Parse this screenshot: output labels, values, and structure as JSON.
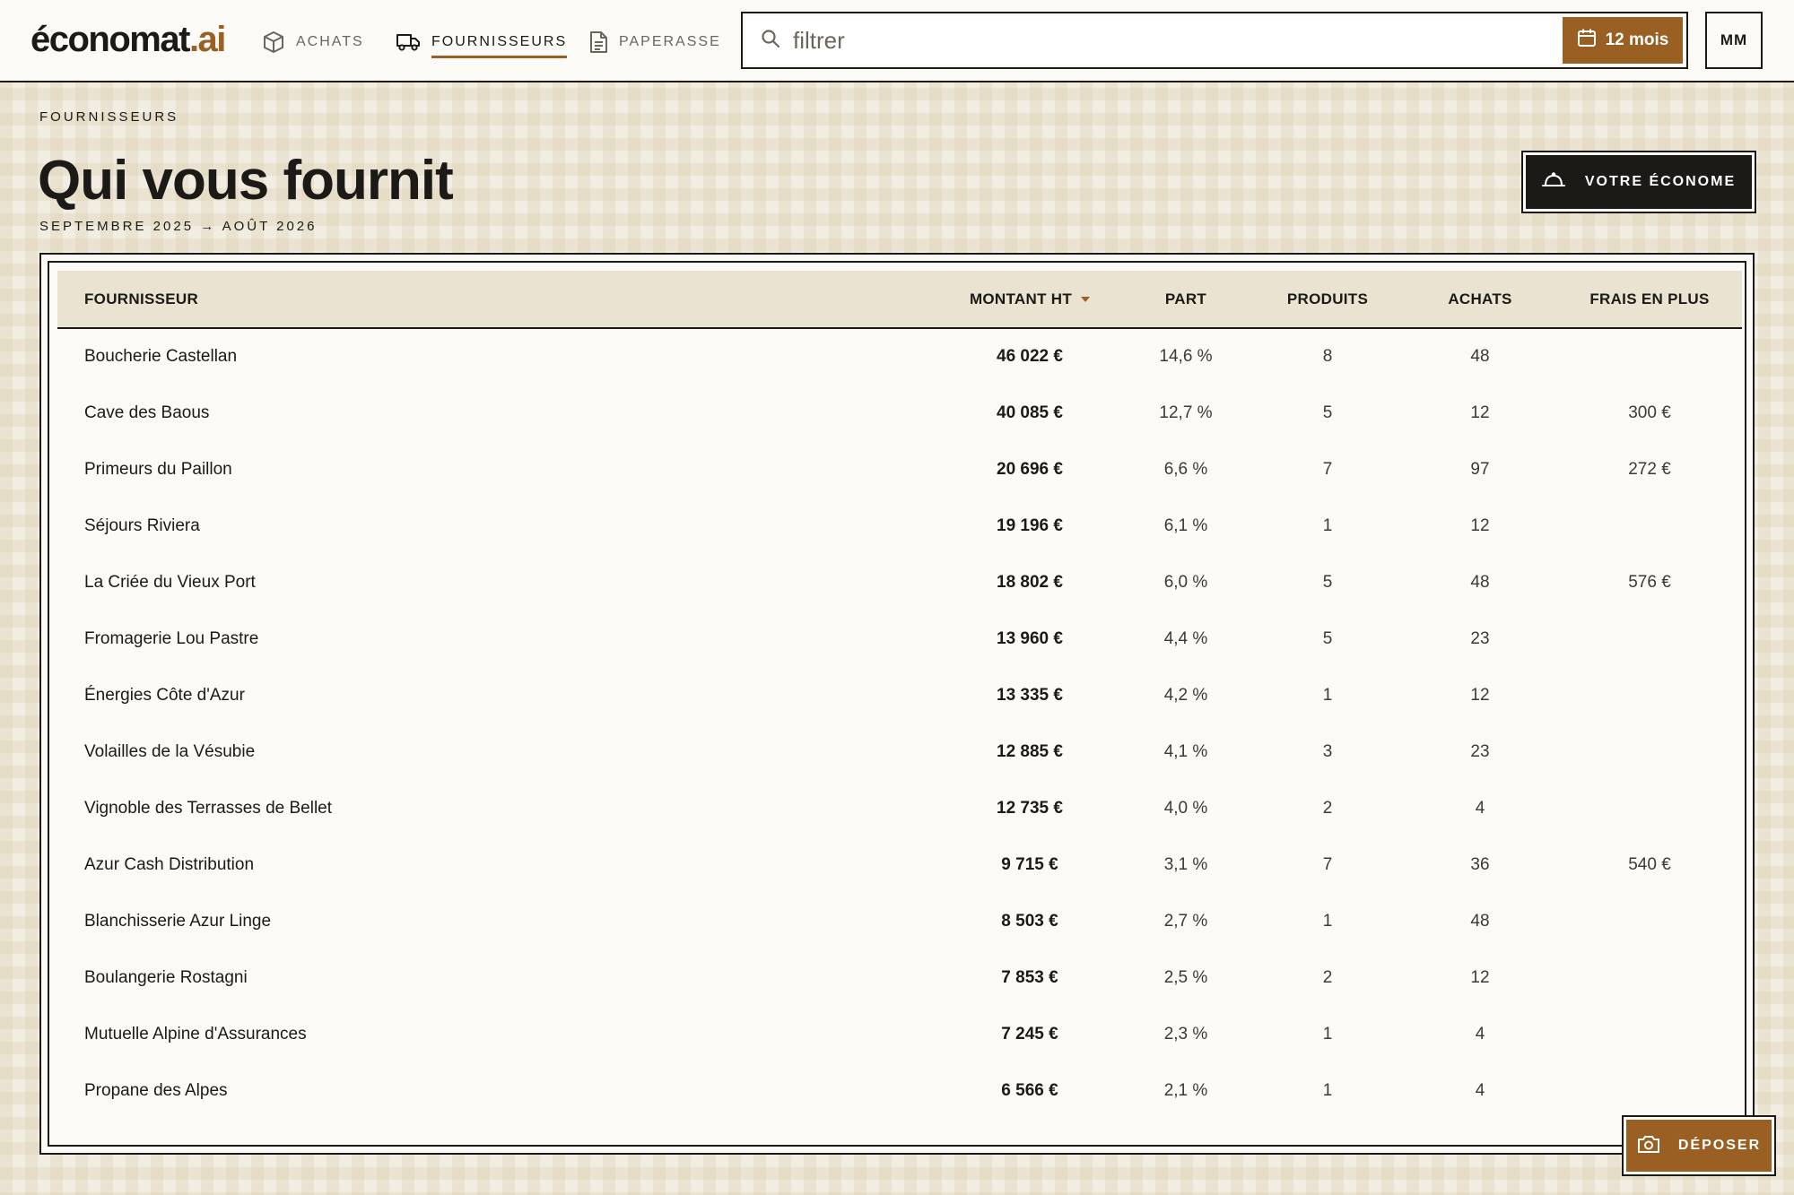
{
  "app": {
    "logo_main": "économat",
    "logo_accent": ".ai"
  },
  "nav": {
    "items": [
      {
        "label": "ACHATS",
        "icon": "box-icon",
        "active": false
      },
      {
        "label": "FOURNISSEURS",
        "icon": "truck-icon",
        "active": true
      },
      {
        "label": "PAPERASSE",
        "icon": "document-icon",
        "active": false
      }
    ]
  },
  "search": {
    "placeholder": "filtrer",
    "value": ""
  },
  "period": {
    "label": "12 mois",
    "icon": "calendar-icon"
  },
  "user": {
    "initials": "MM"
  },
  "header": {
    "eyebrow": "FOURNISSEURS",
    "title": "Qui vous fournit",
    "date_range": "SEPTEMBRE 2025 → AOÛT 2026",
    "econome_label": "VOTRE ÉCONOME",
    "econome_icon": "cloche-icon"
  },
  "table": {
    "columns": {
      "supplier": "FOURNISSEUR",
      "amount": "MONTANT HT",
      "share": "PART",
      "products": "PRODUITS",
      "purchases": "ACHATS",
      "extra_fees": "FRAIS EN PLUS"
    },
    "sort": {
      "column": "amount",
      "direction": "desc"
    },
    "rows": [
      {
        "name": "Boucherie Castellan",
        "amount": "46 022 €",
        "share": "14,6 %",
        "products": "8",
        "purchases": "48",
        "extra": ""
      },
      {
        "name": "Cave des Baous",
        "amount": "40 085 €",
        "share": "12,7 %",
        "products": "5",
        "purchases": "12",
        "extra": "300 €"
      },
      {
        "name": "Primeurs du Paillon",
        "amount": "20 696 €",
        "share": "6,6 %",
        "products": "7",
        "purchases": "97",
        "extra": "272 €"
      },
      {
        "name": "Séjours Riviera",
        "amount": "19 196 €",
        "share": "6,1 %",
        "products": "1",
        "purchases": "12",
        "extra": ""
      },
      {
        "name": "La Criée du Vieux Port",
        "amount": "18 802 €",
        "share": "6,0 %",
        "products": "5",
        "purchases": "48",
        "extra": "576 €"
      },
      {
        "name": "Fromagerie Lou Pastre",
        "amount": "13 960 €",
        "share": "4,4 %",
        "products": "5",
        "purchases": "23",
        "extra": ""
      },
      {
        "name": "Énergies Côte d'Azur",
        "amount": "13 335 €",
        "share": "4,2 %",
        "products": "1",
        "purchases": "12",
        "extra": ""
      },
      {
        "name": "Volailles de la Vésubie",
        "amount": "12 885 €",
        "share": "4,1 %",
        "products": "3",
        "purchases": "23",
        "extra": ""
      },
      {
        "name": "Vignoble des Terrasses de Bellet",
        "amount": "12 735 €",
        "share": "4,0 %",
        "products": "2",
        "purchases": "4",
        "extra": ""
      },
      {
        "name": "Azur Cash Distribution",
        "amount": "9 715 €",
        "share": "3,1 %",
        "products": "7",
        "purchases": "36",
        "extra": "540 €"
      },
      {
        "name": "Blanchisserie Azur Linge",
        "amount": "8 503 €",
        "share": "2,7 %",
        "products": "1",
        "purchases": "48",
        "extra": ""
      },
      {
        "name": "Boulangerie Rostagni",
        "amount": "7 853 €",
        "share": "2,5 %",
        "products": "2",
        "purchases": "12",
        "extra": ""
      },
      {
        "name": "Mutuelle Alpine d'Assurances",
        "amount": "7 245 €",
        "share": "2,3 %",
        "products": "1",
        "purchases": "4",
        "extra": ""
      },
      {
        "name": "Propane des Alpes",
        "amount": "6 566 €",
        "share": "2,1 %",
        "products": "1",
        "purchases": "4",
        "extra": ""
      }
    ]
  },
  "upload": {
    "label": "DÉPOSER",
    "icon": "camera-icon"
  },
  "colors": {
    "accent": "#9a5f22",
    "ink": "#1c1a17",
    "paper": "#fbfaf6",
    "header_row": "#ebe3d1",
    "background": "#f2ede2"
  }
}
